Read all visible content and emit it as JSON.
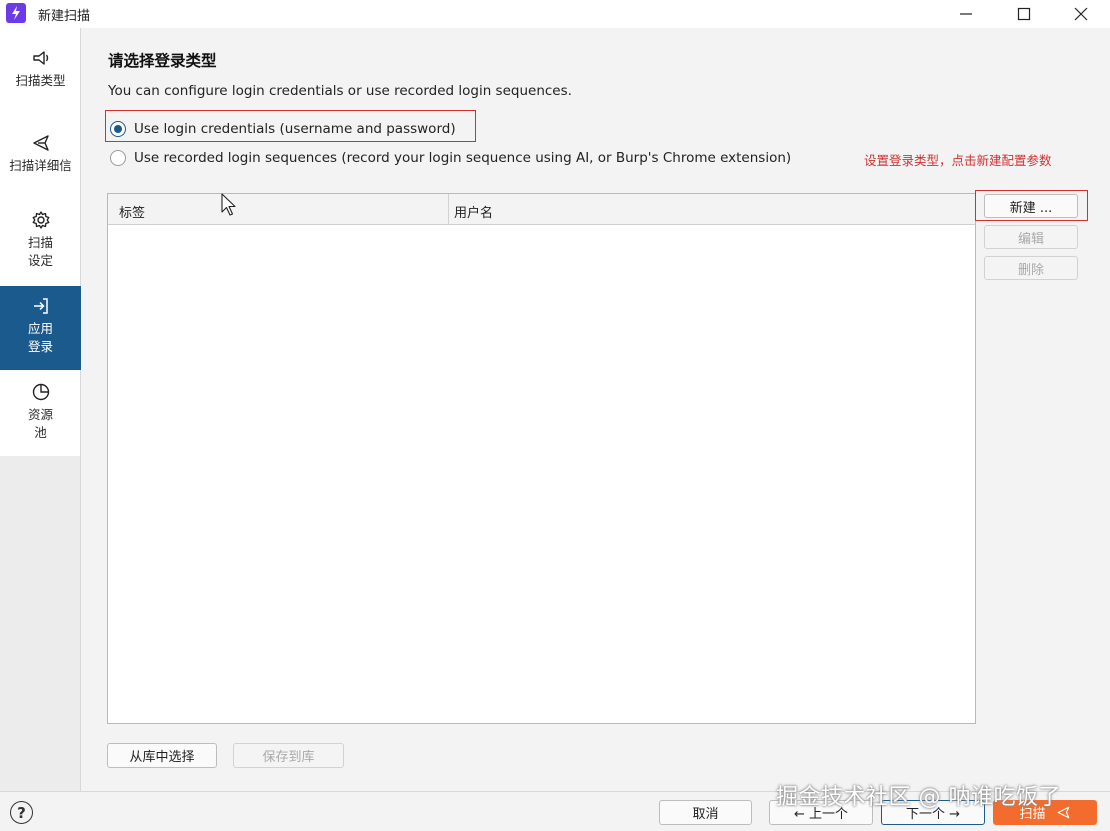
{
  "window": {
    "title": "新建扫描"
  },
  "sidebar": {
    "items": [
      {
        "label": "扫描类型",
        "icon": "scan-type-icon",
        "active": false
      },
      {
        "label": "扫描详细信",
        "icon": "send-icon",
        "active": false
      },
      {
        "label": "扫描设定",
        "icon": "gear-icon",
        "active": false
      },
      {
        "label": "应用登录",
        "icon": "login-icon",
        "active": true
      },
      {
        "label": "资源池",
        "icon": "pie-icon",
        "active": false
      }
    ]
  },
  "main": {
    "heading": "请选择登录类型",
    "description": "You can configure login credentials or use recorded login sequences.",
    "options": [
      {
        "label": "Use login credentials (username and password)",
        "checked": true
      },
      {
        "label": "Use recorded login sequences (record your login sequence using AI, or Burp's Chrome extension)",
        "checked": false
      }
    ],
    "annotation": "设置登录类型，点击新建配置参数",
    "table": {
      "columns": [
        "标签",
        "用户名"
      ],
      "rows": []
    },
    "side_buttons": {
      "new": "新建 ...",
      "edit": "编辑",
      "delete": "删除"
    },
    "library_buttons": {
      "select": "从库中选择",
      "save": "保存到库"
    }
  },
  "footer": {
    "help": "?",
    "cancel": "取消",
    "prev": "← 上一个",
    "next": "下一个 →",
    "scan": "扫描"
  },
  "watermark": "掘金技术社区 @ 呐谁吃饭了",
  "colors": {
    "accent": "#1b5a8c",
    "annotation": "#d23030",
    "scan_button": "#f36c2e"
  }
}
